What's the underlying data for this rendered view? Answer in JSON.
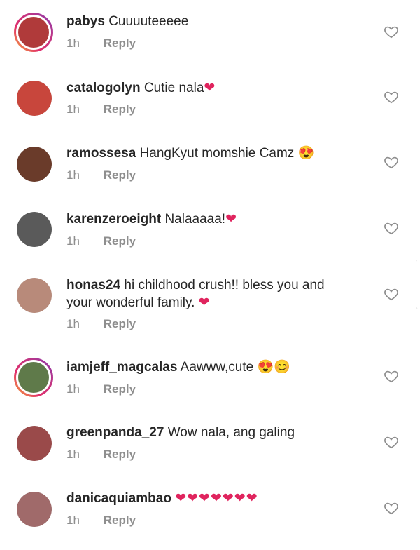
{
  "comments": [
    {
      "username": "pabys",
      "text": "Cuuuuteeeee",
      "emoji": "",
      "time": "1h",
      "reply": "Reply",
      "ring": true,
      "avatar_color": "#b03a3a"
    },
    {
      "username": "catalogolyn",
      "text": "Cutie nala",
      "emoji": "❤",
      "time": "1h",
      "reply": "Reply",
      "ring": false,
      "avatar_color": "#c8463c"
    },
    {
      "username": "ramossesa",
      "text": "HangKyut momshie Camz ",
      "emoji": "😍",
      "time": "1h",
      "reply": "Reply",
      "ring": false,
      "avatar_color": "#6a3b2a"
    },
    {
      "username": "karenzeroeight",
      "text": "Nalaaaaa!",
      "emoji": "❤",
      "time": "1h",
      "reply": "Reply",
      "ring": false,
      "avatar_color": "#5a5a5a"
    },
    {
      "username": "honas24",
      "text": "hi childhood crush!! bless you and your wonderful family. ",
      "emoji": "❤",
      "time": "1h",
      "reply": "Reply",
      "ring": false,
      "avatar_color": "#b88a7a"
    },
    {
      "username": "iamjeff_magcalas",
      "text": "Aawww,cute ",
      "emoji": "😍😊",
      "time": "1h",
      "reply": "Reply",
      "ring": true,
      "avatar_color": "#5f7a4a"
    },
    {
      "username": "greenpanda_27",
      "text": "Wow nala, ang galing",
      "emoji": "",
      "time": "1h",
      "reply": "Reply",
      "ring": false,
      "avatar_color": "#9a4a4a"
    },
    {
      "username": "danicaquiambao",
      "text": "",
      "emoji": "❤❤❤❤❤❤❤",
      "time": "1h",
      "reply": "Reply",
      "ring": false,
      "avatar_color": "#a06a6a"
    }
  ],
  "colors": {
    "heart": "#e0245e",
    "muted": "#8e8e8e",
    "text": "#262626"
  },
  "icons": {
    "like": "heart-outline-icon"
  }
}
